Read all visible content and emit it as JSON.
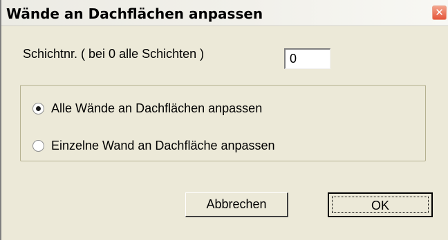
{
  "window": {
    "title": "Wände an Dachflächen anpassen",
    "close_glyph": "✕"
  },
  "layer": {
    "label": "Schichtnr. ( bei 0 alle Schichten )",
    "value": "0"
  },
  "options": [
    {
      "label": "Alle Wände an Dachflächen anpassen",
      "selected": true
    },
    {
      "label": "Einzelne Wand an Dachfläche anpassen",
      "selected": false
    }
  ],
  "buttons": {
    "cancel": "Abbrechen",
    "ok": "OK"
  },
  "colors": {
    "dialog_background": "#ECE9D8",
    "close_button": "#E5553A",
    "group_border": "#B5B190"
  }
}
